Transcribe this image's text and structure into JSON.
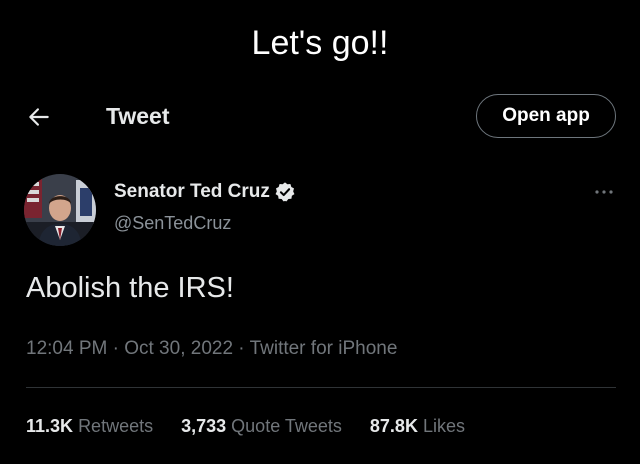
{
  "caption": "Let's go!!",
  "header": {
    "title": "Tweet",
    "back_icon": "back-arrow-icon",
    "open_app_label": "Open app"
  },
  "author": {
    "display_name": "Senator Ted Cruz",
    "handle": "@SenTedCruz",
    "verified_icon": "verified-badge-icon",
    "more_icon": "more-options-icon"
  },
  "tweet": {
    "text": "Abolish the IRS!",
    "time": "12:04 PM",
    "date": "Oct 30, 2022",
    "source": "Twitter for iPhone",
    "separator": "·"
  },
  "stats": {
    "retweets_count": "11.3K",
    "retweets_label": "Retweets",
    "quotes_count": "3,733",
    "quotes_label": "Quote Tweets",
    "likes_count": "87.8K",
    "likes_label": "Likes"
  },
  "colors": {
    "background": "#000000",
    "primary_text": "#e7e9ea",
    "secondary_text": "#71767b",
    "divider": "#2f3336"
  }
}
